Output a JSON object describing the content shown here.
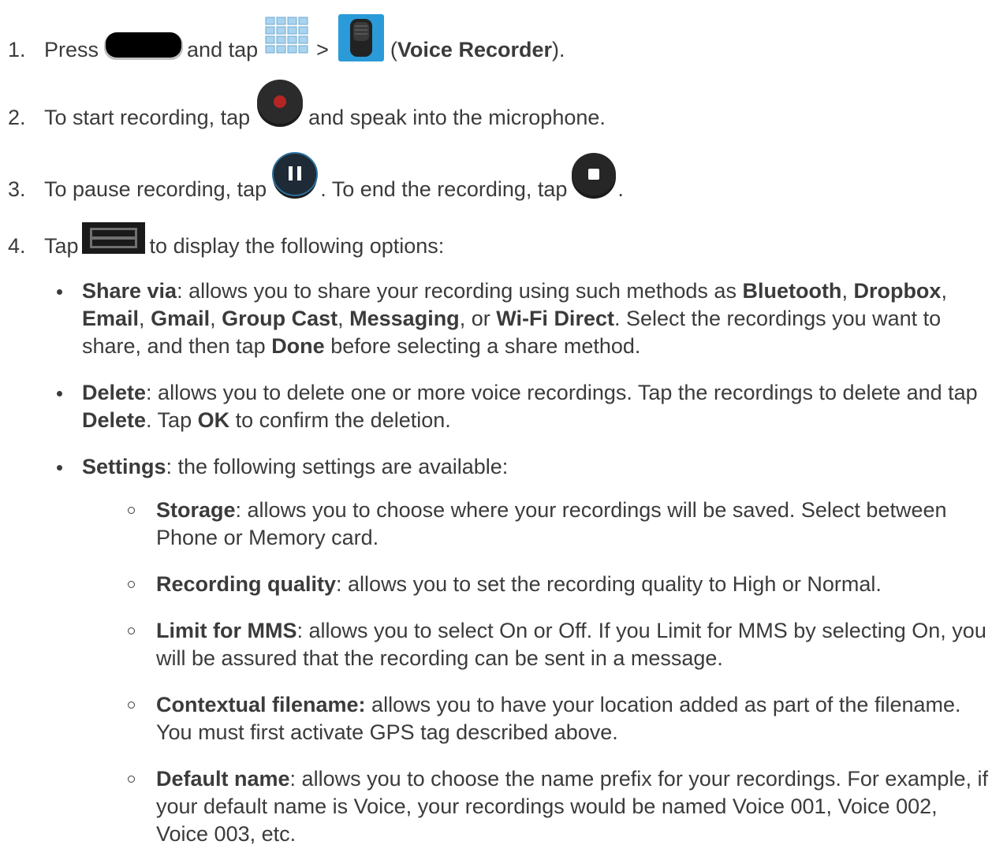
{
  "steps": [
    {
      "num": "1.",
      "t1": "Press",
      "t2": "and tap",
      "t3": ">",
      "t4": "(",
      "bold": "Voice Recorder",
      "t5": ")."
    },
    {
      "num": "2.",
      "t1": "To start recording, tap",
      "t2": "and speak into the microphone."
    },
    {
      "num": "3.",
      "t1": "To pause recording, tap",
      "t2": ". To end the recording, tap",
      "t3": "."
    },
    {
      "num": "4.",
      "t1": "Tap",
      "t2": "to display the following options:"
    }
  ],
  "options": {
    "share": {
      "title": "Share via",
      "text1": ": allows you to share your recording using such methods as ",
      "m1": "Bluetooth",
      "c1": ", ",
      "m2": "Dropbox",
      "c2": ", ",
      "m3": "Email",
      "c3": ", ",
      "m4": "Gmail",
      "c4": ", ",
      "m5": "Group Cast",
      "c5": ", ",
      "m6": "Messaging",
      "c6": ", or ",
      "m7": "Wi-Fi Direct",
      "text2": ". Select the recordings you want to share, and then tap ",
      "done": "Done",
      "text3": " before selecting a share method."
    },
    "delete": {
      "title": "Delete",
      "text1": ": allows you to delete one or more voice recordings. Tap the recordings to delete and tap ",
      "del": "Delete",
      "text2": ". Tap ",
      "ok": "OK",
      "text3": " to confirm the deletion."
    },
    "settings": {
      "title": "Settings",
      "text1": ": the following settings are available:",
      "items": [
        {
          "title": "Storage",
          "text": ": allows you to choose where your recordings will be saved. Select between Phone or Memory card."
        },
        {
          "title": "Recording quality",
          "text": ": allows you to set the recording quality to High or Normal."
        },
        {
          "title": "Limit for MMS",
          "text": ": allows you to select On or Off. If you Limit for MMS by selecting On, you will be assured that the recording can be sent in a message."
        },
        {
          "title": "Contextual filename:",
          "text": " allows you to have your location added as part of the filename. You must first activate GPS tag described above."
        },
        {
          "title": "Default name",
          "text": ": allows you to choose the name prefix for your recordings. For example, if your default name is Voice, your recordings would be named Voice 001, Voice 002, Voice 003, etc."
        }
      ]
    }
  },
  "icons": [
    "home-key-icon",
    "apps-grid-icon",
    "voice-recorder-app-icon",
    "record-icon",
    "pause-icon",
    "stop-icon",
    "menu-key-icon"
  ]
}
